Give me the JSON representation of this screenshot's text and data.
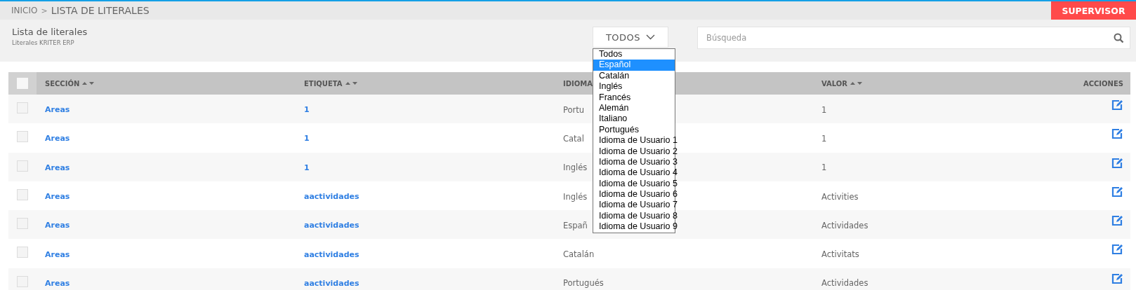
{
  "breadcrumb": {
    "items": [
      {
        "label": "INICIO"
      },
      {
        "label": "LISTA DE LITERALES"
      }
    ],
    "separator": ">"
  },
  "user_button": "SUPERVISOR",
  "page": {
    "title": "Lista de literales",
    "subtitle": "Literales KRITER ERP"
  },
  "language_filter": {
    "value": "TODOS",
    "options": [
      {
        "label": "Todos",
        "selected": false
      },
      {
        "label": "Español",
        "selected": true
      },
      {
        "label": "Catalán",
        "selected": false
      },
      {
        "label": "Inglés",
        "selected": false
      },
      {
        "label": "Francés",
        "selected": false
      },
      {
        "label": "Alemán",
        "selected": false
      },
      {
        "label": "Italiano",
        "selected": false
      },
      {
        "label": "Portugués",
        "selected": false
      },
      {
        "label": "Idioma de Usuario 1",
        "selected": false
      },
      {
        "label": "Idioma de Usuario 2",
        "selected": false
      },
      {
        "label": "Idioma de Usuario 3",
        "selected": false
      },
      {
        "label": "Idioma de Usuario 4",
        "selected": false
      },
      {
        "label": "Idioma de Usuario 5",
        "selected": false
      },
      {
        "label": "Idioma de Usuario 6",
        "selected": false
      },
      {
        "label": "Idioma de Usuario 7",
        "selected": false
      },
      {
        "label": "Idioma de Usuario 8",
        "selected": false
      },
      {
        "label": "Idioma de Usuario 9",
        "selected": false
      }
    ]
  },
  "search": {
    "placeholder": "Búsqueda"
  },
  "table": {
    "select_all_checked": false,
    "columns": [
      {
        "label": "SECCIÓN",
        "sortable": true
      },
      {
        "label": "ETIQUETA",
        "sortable": true
      },
      {
        "label": "IDIOMA"
      },
      {
        "label": "VALOR",
        "sortable": true
      },
      {
        "label": "ACCIONES",
        "sortable": false
      }
    ],
    "rows": [
      {
        "checked": false,
        "section": "Areas",
        "tag": "1",
        "language": "Portu",
        "value": "1"
      },
      {
        "checked": false,
        "section": "Areas",
        "tag": "1",
        "language": "Catal",
        "value": "1"
      },
      {
        "checked": false,
        "section": "Areas",
        "tag": "1",
        "language": "Inglés",
        "value": "1"
      },
      {
        "checked": false,
        "section": "Areas",
        "tag": "aactividades",
        "language": "Inglés",
        "value": "Activities"
      },
      {
        "checked": false,
        "section": "Areas",
        "tag": "aactividades",
        "language": "Españ",
        "value": "Actividades"
      },
      {
        "checked": false,
        "section": "Areas",
        "tag": "aactividades",
        "language": "Catalán",
        "value": "Activitats"
      },
      {
        "checked": false,
        "section": "Areas",
        "tag": "aactividades",
        "language": "Portugués",
        "value": "Actividades"
      }
    ]
  }
}
